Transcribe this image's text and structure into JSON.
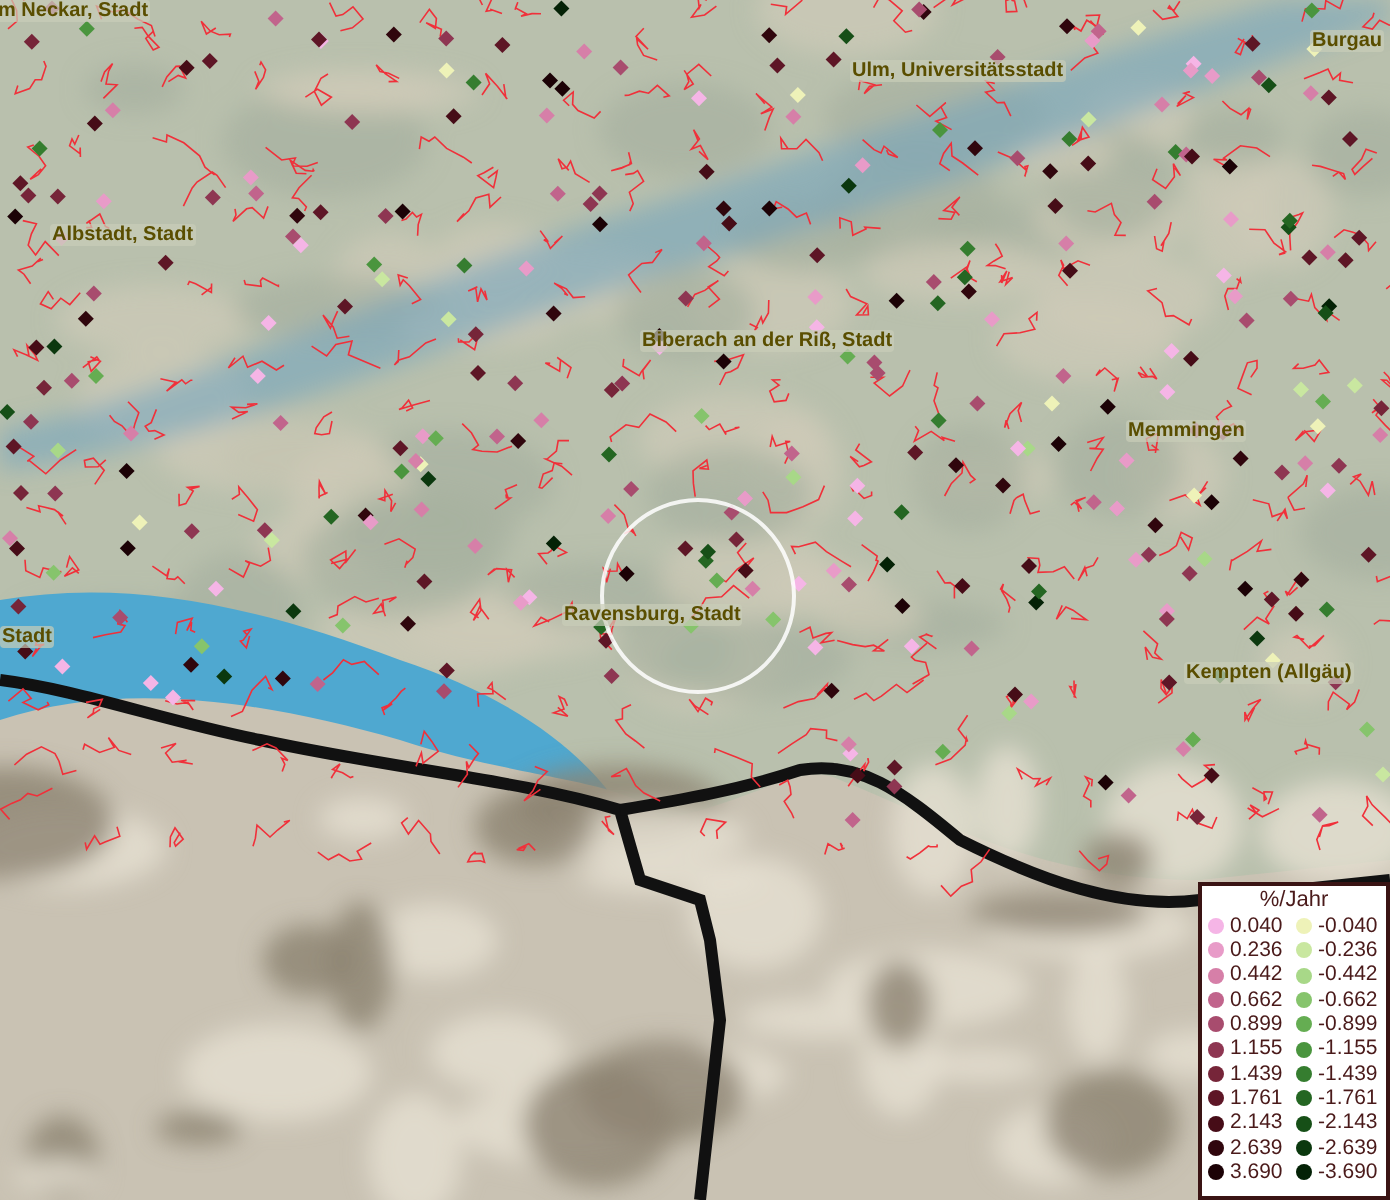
{
  "map": {
    "place_labels": [
      {
        "text": "m Neckar, Stadt"
      },
      {
        "text": "Ulm, Universitätsstadt"
      },
      {
        "text": "Burgau"
      },
      {
        "text": "Albstadt, Stadt"
      },
      {
        "text": "Biberach an der Riß, Stadt"
      },
      {
        "text": "Memmingen"
      },
      {
        "text": "Stadt"
      },
      {
        "text": "Ravensburg, Stadt"
      },
      {
        "text": "Kempten (Allgäu)"
      }
    ]
  },
  "legend": {
    "title": "%/Jahr",
    "columns": [
      [
        {
          "label": "0.040",
          "color": "#f5b5e6"
        },
        {
          "label": "0.236",
          "color": "#e89bc8"
        },
        {
          "label": "0.442",
          "color": "#d67fa8"
        },
        {
          "label": "0.662",
          "color": "#c1648c"
        },
        {
          "label": "0.899",
          "color": "#a84c6e"
        },
        {
          "label": "1.155",
          "color": "#8e3652"
        },
        {
          "label": "1.439",
          "color": "#762539"
        },
        {
          "label": "1.761",
          "color": "#5e1626"
        },
        {
          "label": "2.143",
          "color": "#460c17"
        },
        {
          "label": "2.639",
          "color": "#30060d"
        },
        {
          "label": "3.690",
          "color": "#1c0206"
        }
      ],
      [
        {
          "label": "-0.040",
          "color": "#eef2b8"
        },
        {
          "label": "-0.236",
          "color": "#c9e7a0"
        },
        {
          "label": "-0.442",
          "color": "#a8d888"
        },
        {
          "label": "-0.662",
          "color": "#86c46c"
        },
        {
          "label": "-0.899",
          "color": "#65ad52"
        },
        {
          "label": "-1.155",
          "color": "#4a953e"
        },
        {
          "label": "-1.439",
          "color": "#357d2f"
        },
        {
          "label": "-1.761",
          "color": "#246622"
        },
        {
          "label": "-2.143",
          "color": "#164f17"
        },
        {
          "label": "-2.639",
          "color": "#0b380e"
        },
        {
          "label": "-3.690",
          "color": "#042206"
        }
      ]
    ]
  }
}
